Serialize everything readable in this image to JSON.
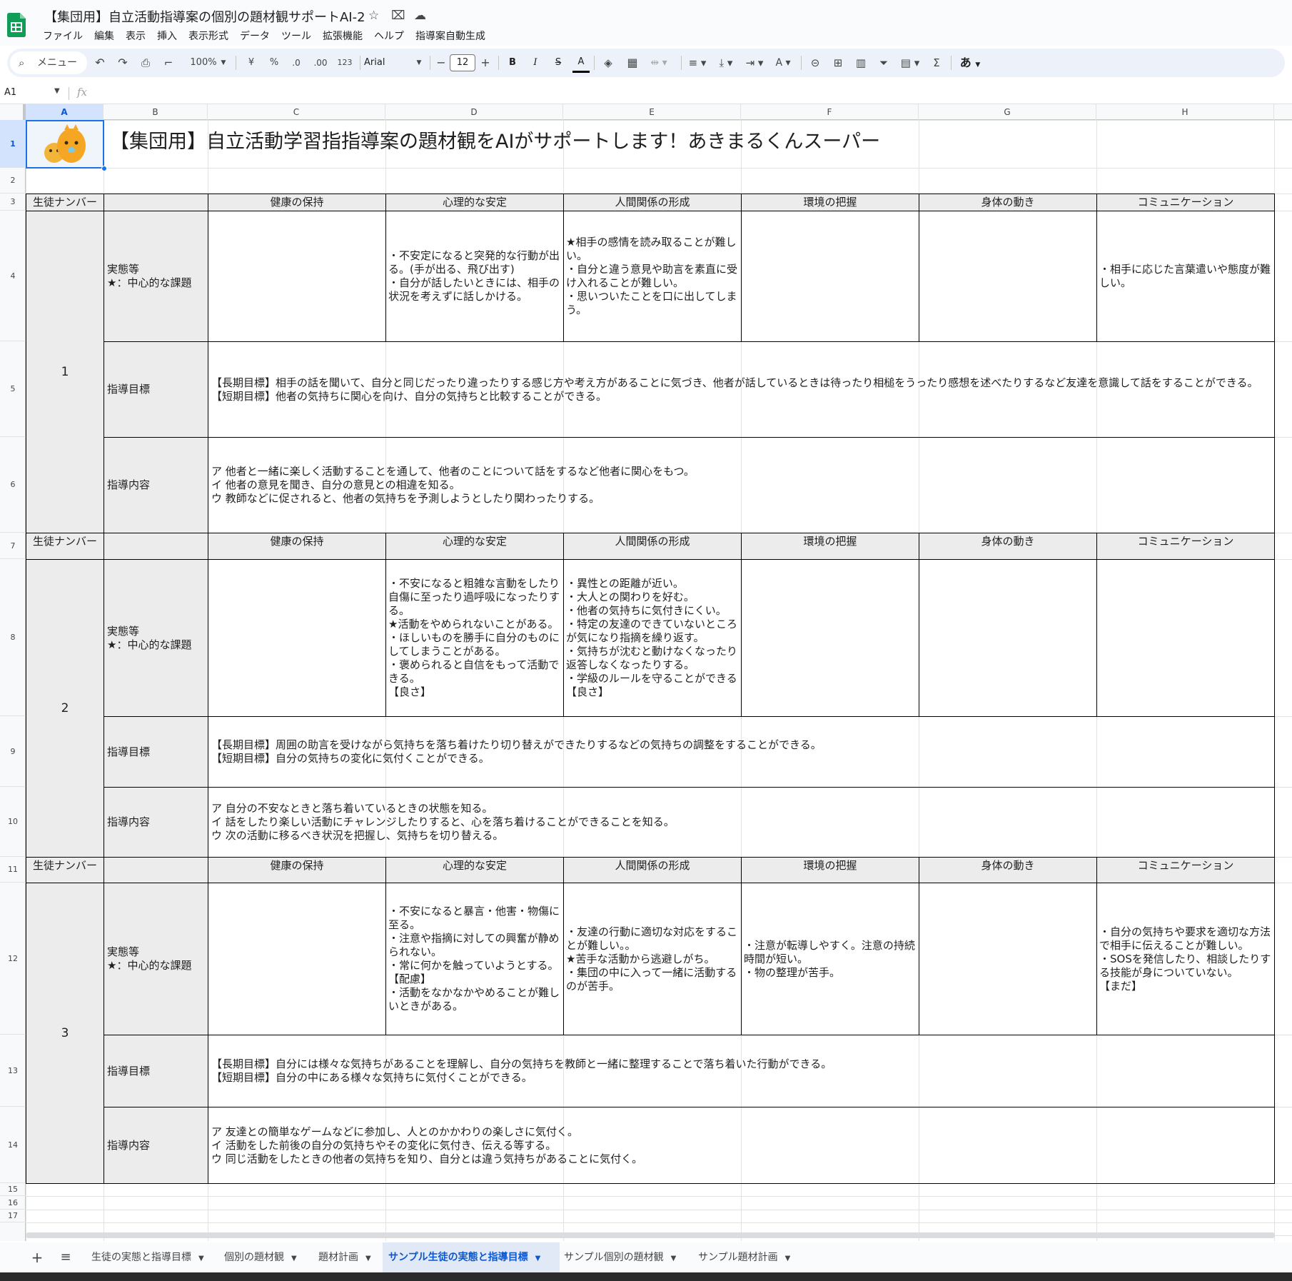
{
  "doc_title": "【集団用】自立活動指導案の個別の題材観サポートAI-2",
  "menu": [
    "ファイル",
    "編集",
    "表示",
    "挿入",
    "表示形式",
    "データ",
    "ツール",
    "拡張機能",
    "ヘルプ",
    "指導案自動生成"
  ],
  "toolbar": {
    "menu_search": "メニュー",
    "zoom": "100%",
    "currency": "¥",
    "percent": "%",
    "dec_decrease": ".0",
    "dec_increase": ".00",
    "number_format": "123",
    "font": "Arial",
    "minus": "−",
    "font_size": "12",
    "plus": "+",
    "bold": "B",
    "italic": "I",
    "input_tools": "あ"
  },
  "formula_bar": {
    "name_box": "A1",
    "fx": "fx"
  },
  "columns": [
    "A",
    "B",
    "C",
    "D",
    "E",
    "F",
    "G",
    "H"
  ],
  "rows": [
    "1",
    "2",
    "3",
    "4",
    "5",
    "6",
    "7",
    "8",
    "9",
    "10",
    "11",
    "12",
    "13",
    "14",
    "15",
    "16",
    "17"
  ],
  "sheet_title": "【集団用】自立活動学習指指導案の題材観をAIがサポートします！あきまるくんスーパー",
  "header_labels": {
    "student_number": "生徒ナンバー",
    "health": "健康の保持",
    "psych": "心理的な安定",
    "relations": "人間関係の形成",
    "environment": "環境の把握",
    "body": "身体の動き",
    "communication": "コミュニケーション"
  },
  "row_labels": {
    "status": "実態等\n★：中心的な課題",
    "goals": "指導目標",
    "content": "指導内容"
  },
  "students": [
    {
      "number": "1",
      "status": {
        "health": "",
        "psych": "・不安定になると突発的な行動が出る。(手が出る、飛び出す)\n・自分が話したいときには、相手の状況を考えずに話しかける。",
        "relations": "★相手の感情を読み取ることが難しい。\n・自分と違う意見や助言を素直に受け入れることが難しい。\n・思いついたことを口に出してしまう。",
        "environment": "",
        "body": "",
        "communication": "・相手に応じた言葉遣いや態度が難しい。"
      },
      "goals": "【長期目標】相手の話を聞いて、自分と同じだったり違ったりする感じ方や考え方があることに気づき、他者が話しているときは待ったり相槌をうったり感想を述べたりするなど友達を意識して話をすることができる。\n【短期目標】他者の気持ちに関心を向け、自分の気持ちと比較することができる。",
      "content": "ア 他者と一緒に楽しく活動することを通して、他者のことについて話をするなど他者に関心をもつ。\nイ 他者の意見を聞き、自分の意見との相違を知る。\nウ 教師などに促されると、他者の気持ちを予測しようとしたり関わったりする。"
    },
    {
      "number": "2",
      "status": {
        "health": "",
        "psych": "・不安になると粗雑な言動をしたり自傷に至ったり過呼吸になったりする。\n★活動をやめられないことがある。\n・ほしいものを勝手に自分のものにしてしまうことがある。\n・褒められると自信をもって活動できる。\n【良さ】",
        "relations": "・異性との距離が近い。\n・大人との関わりを好む。\n・他者の気持ちに気付きにくい。\n・特定の友達のできていないところが気になり指摘を繰り返す。\n・気持ちが沈むと動けなくなったり返答しなくなったりする。\n・学級のルールを守ることができる【良さ】",
        "environment": "",
        "body": "",
        "communication": ""
      },
      "goals": "【長期目標】周囲の助言を受けながら気持ちを落ち着けたり切り替えができたりするなどの気持ちの調整をすることができる。\n【短期目標】自分の気持ちの変化に気付くことができる。",
      "content": "ア 自分の不安なときと落ち着いているときの状態を知る。\nイ 話をしたり楽しい活動にチャレンジしたりすると、心を落ち着けることができることを知る。\nウ 次の活動に移るべき状況を把握し、気持ちを切り替える。"
    },
    {
      "number": "3",
      "status": {
        "health": "",
        "psych": "・不安になると暴言・他害・物傷に至る。\n・注意や指摘に対しての興奮が静められない。\n・常に何かを触っていようとする。【配慮】\n・活動をなかなかやめることが難しいときがある。",
        "relations": "・友達の行動に適切な対応をすることが難しい。。\n★苦手な活動から逃避しがち。\n・集団の中に入って一緒に活動するのが苦手。",
        "environment": "・注意が転導しやすく。注意の持続時間が短い。\n・物の整理が苦手。",
        "body": "",
        "communication": "・自分の気持ちや要求を適切な方法で相手に伝えることが難しい。\n・SOSを発信したり、相談したりする技能が身についていない。\n【まだ】"
      },
      "goals": "【長期目標】自分には様々な気持ちがあることを理解し、自分の気持ちを教師と一緒に整理することで落ち着いた行動ができる。\n【短期目標】自分の中にある様々な気持ちに気付くことができる。",
      "content": "ア 友達との簡単なゲームなどに参加し、人とのかかわりの楽しさに気付く。\nイ 活動をした前後の自分の気持ちやその変化に気付き、伝える等する。\nウ 同じ活動をしたときの他者の気持ちを知り、自分とは違う気持ちがあることに気付く。"
    }
  ],
  "sheet_tabs": [
    "生徒の実態と指導目標",
    "個別の題材観",
    "題材計画",
    "サンプル生徒の実態と指導目標",
    "サンプル個別の題材観",
    "サンプル題材計画"
  ],
  "active_tab_index": 3,
  "colors": {
    "accent": "#0b57d0",
    "selection": "#1a73e8",
    "header_fill": "#ececec",
    "sheets_green": "#0f9d58"
  }
}
